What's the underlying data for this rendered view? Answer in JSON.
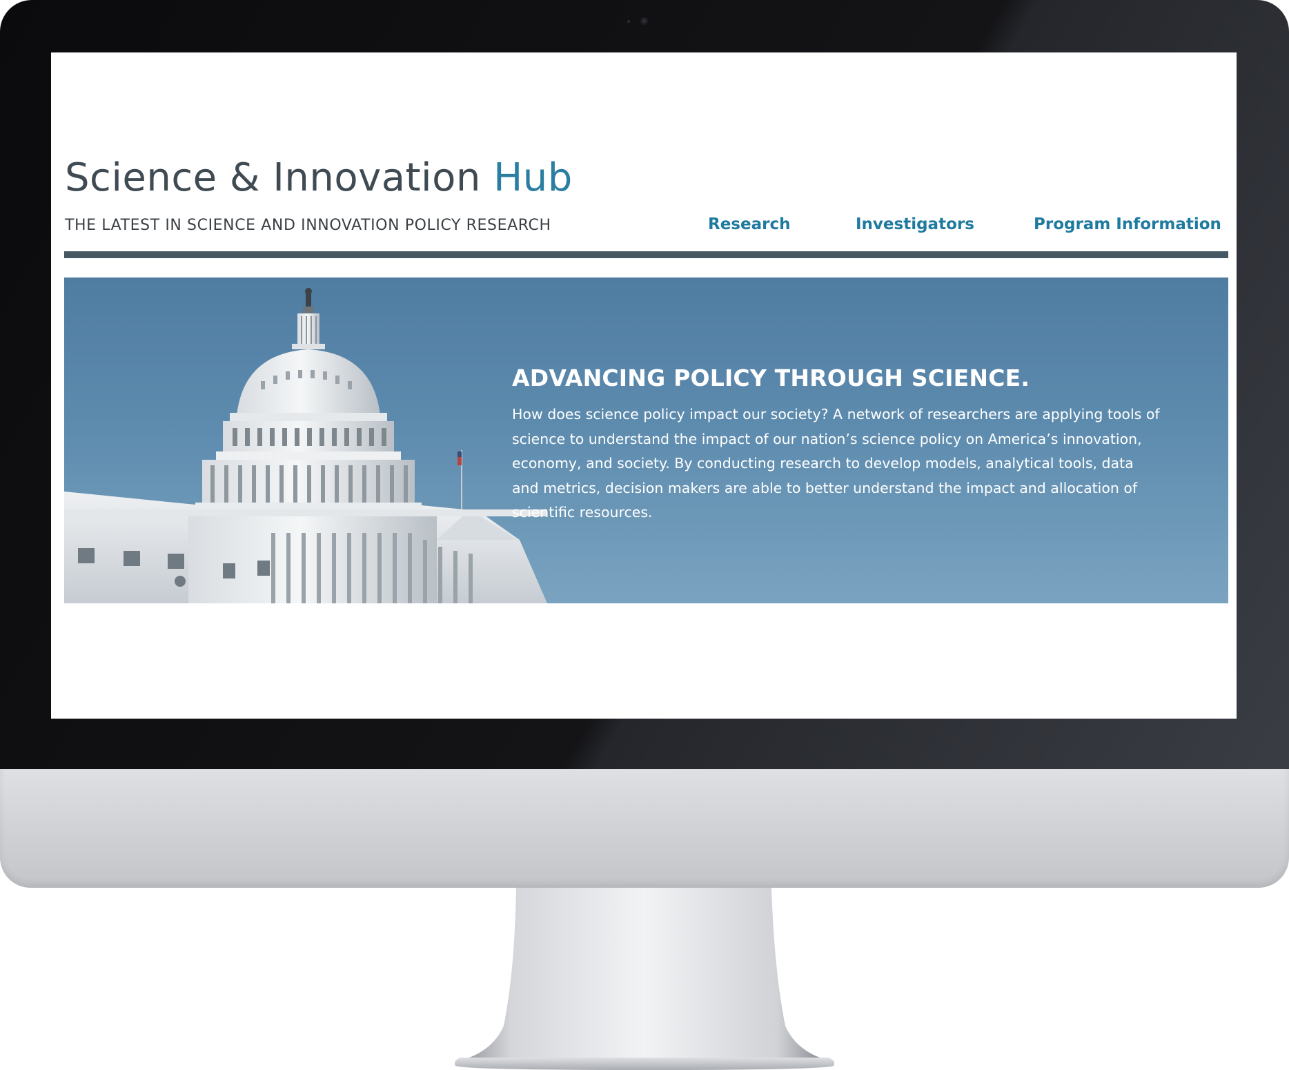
{
  "site": {
    "title_main": "Science & Innovation ",
    "title_accent": "Hub",
    "tagline": "THE LATEST IN SCIENCE AND INNOVATION POLICY RESEARCH"
  },
  "nav": {
    "items": [
      {
        "label": "Research"
      },
      {
        "label": "Investigators"
      },
      {
        "label": "Program Information"
      }
    ]
  },
  "hero": {
    "heading": "ADVANCING POLICY THROUGH SCIENCE.",
    "body_lines": [
      "How does science policy impact our society? A network of researchers are applying tools of",
      "science to understand the impact of our nation’s science policy on America’s innovation,",
      "economy, and society. By conducting research to develop models, analytical tools, data",
      "and metrics, decision makers are able to better understand the impact and allocation of",
      "scientific resources."
    ]
  },
  "colors": {
    "accent": "#2b7ea1",
    "nav_link": "#1f7aa0",
    "title_text": "#3f4a52",
    "rule": "#455863",
    "hero_bg": "#5d8bae"
  }
}
